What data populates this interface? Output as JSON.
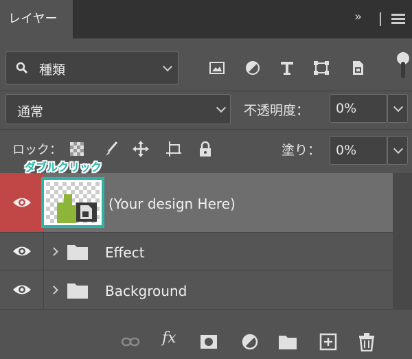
{
  "panel": {
    "tab_label": "レイヤー",
    "collapse_glyph": "»"
  },
  "filter": {
    "kind_label": "種類",
    "icons": [
      "image-filter-icon",
      "adjustment-filter-icon",
      "type-filter-icon",
      "shape-filter-icon",
      "smart-object-filter-icon"
    ]
  },
  "blend": {
    "mode": "通常",
    "opacity_label": "不透明度：",
    "opacity_value": "0%"
  },
  "lock": {
    "label": "ロック：",
    "icons": [
      "lock-transparent-pixels-icon",
      "lock-image-pixels-icon",
      "lock-position-icon",
      "lock-artboard-icon",
      "lock-all-icon"
    ],
    "fill_label": "塗り：",
    "fill_value": "0%"
  },
  "annotation": "ダブルクリック",
  "layers": [
    {
      "name": "(Your design Here)",
      "type": "smart-object",
      "selected": true
    },
    {
      "name": "Effect",
      "type": "group",
      "selected": false
    },
    {
      "name": "Background",
      "type": "group",
      "selected": false
    }
  ],
  "bottom_icons": [
    "link-layers-icon",
    "fx-icon",
    "add-mask-icon",
    "new-adjustment-layer-icon",
    "new-group-icon",
    "new-layer-icon",
    "delete-layer-icon"
  ],
  "colors": {
    "panel_bg": "#535353",
    "selected_eye": "#c14747",
    "selected_row": "#6e6e6e",
    "annotation": "#2bb5a6"
  }
}
